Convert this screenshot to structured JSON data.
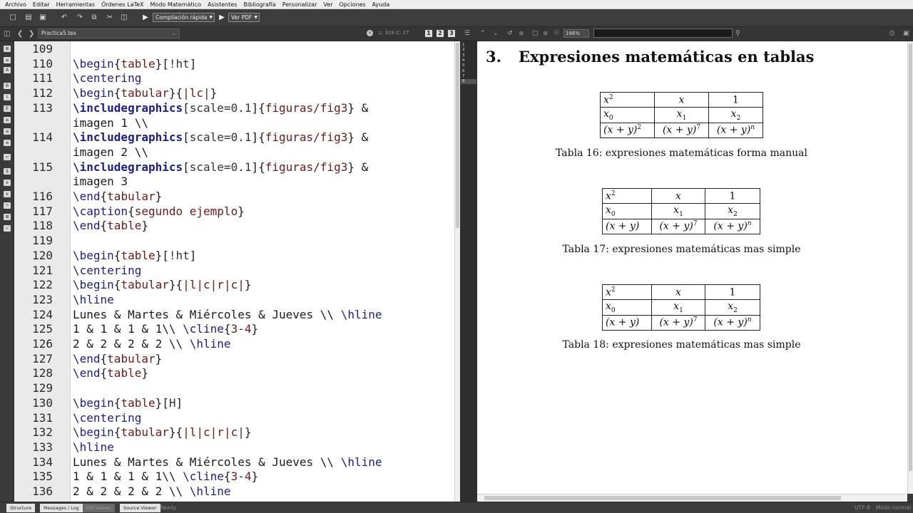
{
  "menu": [
    "Archivo",
    "Editar",
    "Herramientas",
    "Órdenes LaTeX",
    "Modo Matemático",
    "Asistentes",
    "Bibliografía",
    "Personalizar",
    "Ver",
    "Opciones",
    "Ayuda"
  ],
  "toolbar": {
    "compile_label": "Compilación rápida",
    "view_label": "Ver PDF"
  },
  "tab": {
    "filename": "Practica5.tex",
    "linecol": "L: 319 C: 27"
  },
  "viewer": {
    "layout_buttons": [
      "1",
      "2",
      "3"
    ],
    "zoom": "166%"
  },
  "editor": {
    "lines": [
      {
        "n": "109",
        "text": ""
      },
      {
        "n": "110",
        "text": "\\begin{table}[!ht]"
      },
      {
        "n": "111",
        "text": "\\centering"
      },
      {
        "n": "112",
        "text": "\\begin{tabular}{|lc|}"
      },
      {
        "n": "113",
        "text": "\\includegraphics[scale=0.1]{figuras/fig3} &"
      },
      {
        "n": "",
        "text": "imagen 1 \\\\"
      },
      {
        "n": "114",
        "text": "\\includegraphics[scale=0.1]{figuras/fig3} &"
      },
      {
        "n": "",
        "text": "imagen 2 \\\\"
      },
      {
        "n": "115",
        "text": "\\includegraphics[scale=0.1]{figuras/fig3} &"
      },
      {
        "n": "",
        "text": "imagen 3"
      },
      {
        "n": "116",
        "text": "\\end{tabular}"
      },
      {
        "n": "117",
        "text": "\\caption{segundo ejemplo}"
      },
      {
        "n": "118",
        "text": "\\end{table}"
      },
      {
        "n": "119",
        "text": ""
      },
      {
        "n": "120",
        "text": "\\begin{table}[!ht]"
      },
      {
        "n": "121",
        "text": "\\centering"
      },
      {
        "n": "122",
        "text": "\\begin{tabular}{|l|c|r|c|}"
      },
      {
        "n": "123",
        "text": "\\hline"
      },
      {
        "n": "124",
        "text": "Lunes & Martes & Miércoles & Jueves \\\\ \\hline"
      },
      {
        "n": "125",
        "text": "1 & 1 & 1 & 1\\\\ \\cline{3-4}"
      },
      {
        "n": "126",
        "text": "2 & 2 & 2 & 2 \\\\ \\hline"
      },
      {
        "n": "127",
        "text": "\\end{tabular}"
      },
      {
        "n": "128",
        "text": "\\end{table}"
      },
      {
        "n": "129",
        "text": ""
      },
      {
        "n": "130",
        "text": "\\begin{table}[H]"
      },
      {
        "n": "131",
        "text": "\\centering"
      },
      {
        "n": "132",
        "text": "\\begin{tabular}{|l|c|r|c|}"
      },
      {
        "n": "133",
        "text": "\\hline"
      },
      {
        "n": "134",
        "text": "Lunes & Martes & Miércoles & Jueves \\\\ \\hline"
      },
      {
        "n": "135",
        "text": "1 & 1 & 1 & 1\\\\ \\cline{3-4}"
      },
      {
        "n": "136",
        "text": "2 & 2 & 2 & 2 \\\\ \\hline"
      }
    ]
  },
  "structure": [
    "1",
    "2",
    "3",
    "4",
    "5",
    "6",
    "7",
    "8"
  ],
  "pdf": {
    "section_number": "3.",
    "section_title": "Expresiones matemáticas en tablas",
    "tables": [
      {
        "caption": "Tabla 16: expresiones matemáticas forma manual",
        "rows": [
          [
            "x",
            "2",
            "x",
            "",
            "1",
            ""
          ],
          [
            "x",
            "0",
            "x",
            "1",
            "x",
            "2"
          ],
          [
            "(x + y)",
            "2",
            "(x + y)",
            "7",
            "(x + y)",
            "n"
          ]
        ]
      },
      {
        "caption": "Tabla 17: expresiones matemáticas mas simple",
        "rows": [
          [
            "x",
            "2",
            "x",
            "",
            "1",
            ""
          ],
          [
            "x",
            "0",
            "x",
            "1",
            "x",
            "2"
          ],
          [
            "(x + y)",
            "",
            "(x + y)",
            "7",
            "(x + y)",
            "n"
          ]
        ]
      },
      {
        "caption": "Tabla 18: expresiones matemáticas mas simple",
        "rows": [
          [
            "x",
            "2",
            "x",
            "",
            "1",
            ""
          ],
          [
            "x",
            "0",
            "x",
            "1",
            "x",
            "2"
          ],
          [
            "(x + y)",
            "",
            "(x + y)",
            "7",
            "(x + y)",
            "n"
          ]
        ]
      }
    ]
  },
  "status": {
    "buttons": [
      "Structure",
      "Messages / Log",
      "Pdf Viewer",
      "Source Viewer"
    ],
    "ready": "Ready",
    "encoding": "UTF-8",
    "mode": "Modo normal"
  }
}
